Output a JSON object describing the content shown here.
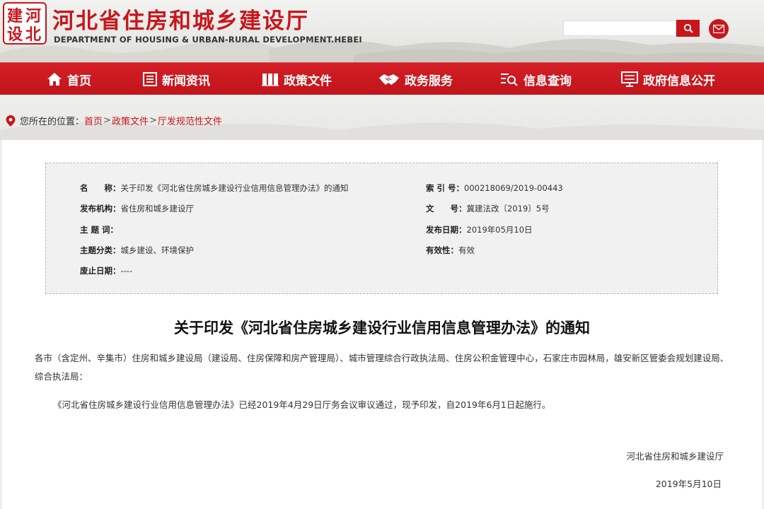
{
  "header": {
    "seal_chars": [
      "建",
      "河",
      "设",
      "北"
    ],
    "title": "河北省住房和城乡建设厅",
    "subtitle": "DEPARTMENT OF HOUSING & URBAN-RURAL DEVELOPMENT.HEBEI",
    "search": {
      "value": "",
      "placeholder": ""
    },
    "search_icon": "search-icon",
    "mail_icon": "mail-icon"
  },
  "nav": {
    "items": [
      {
        "label": "首页",
        "icon": "home-icon"
      },
      {
        "label": "新闻资讯",
        "icon": "news-icon"
      },
      {
        "label": "政策文件",
        "icon": "document-icon"
      },
      {
        "label": "政务服务",
        "icon": "handshake-icon"
      },
      {
        "label": "信息查询",
        "icon": "search-list-icon"
      },
      {
        "label": "政府信息公开",
        "icon": "info-board-icon"
      }
    ]
  },
  "breadcrumb": {
    "prefix": "您所在的位置：",
    "items": [
      "首页",
      "政策文件",
      "厅发规范性文件"
    ],
    "separator": ">"
  },
  "meta": {
    "name_key": "名　　称：",
    "name_val": "关于印发《河北省住房城乡建设行业信用信息管理办法》的通知",
    "index_key": "索 引 号：",
    "index_val": "000218069/2019-00443",
    "org_key": "发布机构：",
    "org_val": "省住房和城乡建设厅",
    "docno_key": "文　　号：",
    "docno_val": "冀建法改〔2019〕5号",
    "subject_key": "主 题 词：",
    "subject_val": "",
    "date_key": "发布日期：",
    "date_val": "2019年05月10日",
    "category_key": "主题分类：",
    "category_val": "城乡建设、环境保护",
    "valid_key": "有效性：",
    "valid_val": "有效",
    "abolish_key": "废止日期：",
    "abolish_val": "----"
  },
  "doc": {
    "title": "关于印发《河北省住房城乡建设行业信用信息管理办法》的通知",
    "para1": "各市（含定州、辛集市）住房和城乡建设局（建设局、住房保障和房产管理局）、城市管理综合行政执法局、住房公积金管理中心，石家庄市园林局，雄安新区管委会规划建设局、综合执法局：",
    "para2": "《河北省住房城乡建设行业信用信息管理办法》已经2019年4月29日厅务会议审议通过，现予印发，自2019年6月1日起施行。",
    "signature_org": "河北省住房和城乡建设厅",
    "signature_date": "2019年5月10日"
  },
  "colors": {
    "brand_red": "#c8161d",
    "nav_red": "#c1141b",
    "link_red": "#c8161d"
  }
}
